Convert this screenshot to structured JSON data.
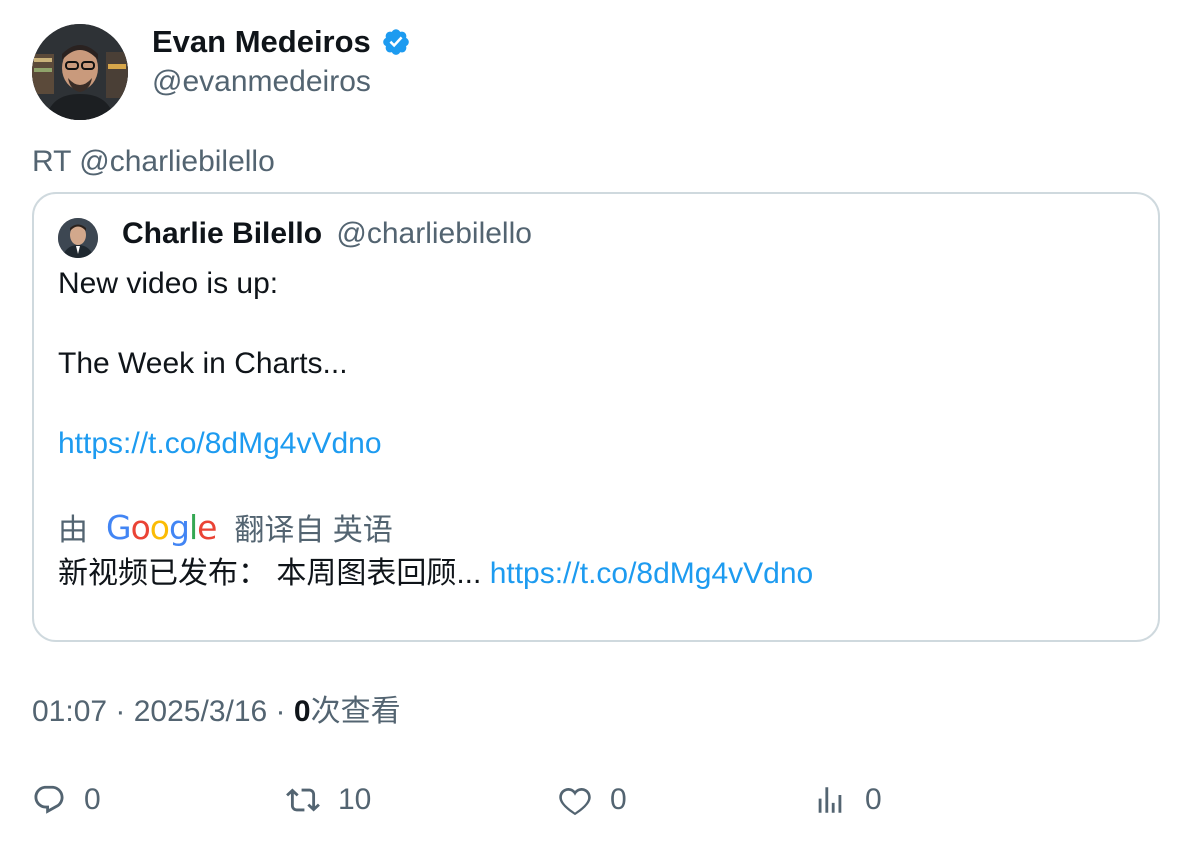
{
  "tweet": {
    "author_name": "Evan Medeiros",
    "author_handle": "@evanmedeiros",
    "retweet_line": "RT @charliebilello",
    "quote": {
      "author_name": "Charlie Bilello",
      "author_handle": "@charliebilello",
      "line1": "New video is up:",
      "line2": "The Week in Charts...",
      "link": "https://t.co/8dMg4vVdno",
      "translated_by": "由",
      "google": "Google",
      "translated_from": "翻译自 英语",
      "translation_text": "新视频已发布： 本周图表回顾...",
      "translation_link": "https://t.co/8dMg4vVdno"
    },
    "meta": {
      "time": "01:07",
      "sep1": " · ",
      "date": "2025/3/16",
      "sep2": " · ",
      "views_count": "0",
      "views_label": "次查看"
    },
    "actions": {
      "replies": "0",
      "retweets": "10",
      "likes": "0",
      "views": "0"
    }
  },
  "icons": {
    "verified": "verified-badge-icon",
    "reply": "reply-icon",
    "retweet": "retweet-icon",
    "like": "heart-icon",
    "views": "analytics-icon"
  },
  "colors": {
    "link": "#1d9bf0",
    "secondary": "#536471",
    "border": "#cfd9de",
    "verified": "#1d9bf0"
  }
}
